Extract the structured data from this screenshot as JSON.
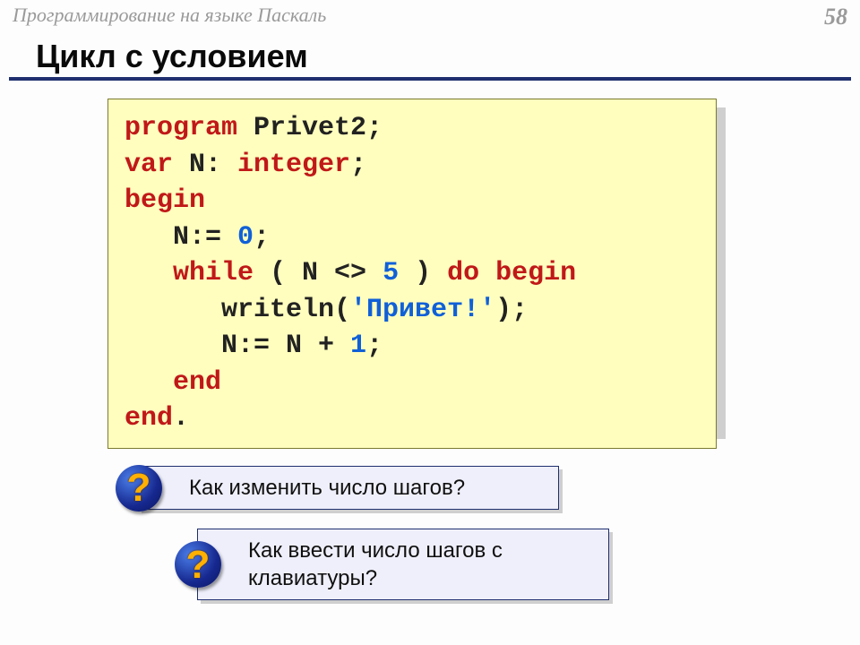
{
  "header": {
    "subject": "Программирование на языке Паскаль",
    "page_number": "58"
  },
  "title": "Цикл с условием",
  "code": {
    "l1_kw": "program",
    "l1_txt": " Privet2;",
    "l2_kw": "var",
    "l2_mid": " N: ",
    "l2_type": "integer",
    "l2_end": ";",
    "l3_kw": "begin",
    "l4_txt1": "   N:= ",
    "l4_lit": "0",
    "l4_txt2": ";",
    "l5_kw1": "   while",
    "l5_txt1": " ( N <> ",
    "l5_lit": "5",
    "l5_txt2": " ) ",
    "l5_kw2": "do begin",
    "l6_txt1": "      writeln(",
    "l6_str": "'Привет!'",
    "l6_txt2": ");",
    "l7_txt1": "      N:= N + ",
    "l7_lit": "1",
    "l7_txt2": ";",
    "l8_kw": "   end",
    "l9_kw": "end",
    "l9_dot": "."
  },
  "questions": {
    "mark": "?",
    "q1": " Как изменить число шагов?",
    "q2": " Как ввести число шагов с\nклавиатуры?"
  }
}
